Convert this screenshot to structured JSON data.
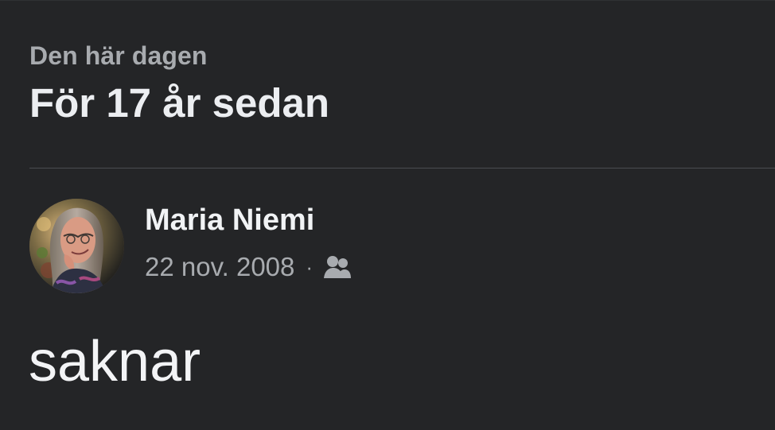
{
  "memory": {
    "eyebrow": "Den här dagen",
    "headline": "För 17 år sedan"
  },
  "post": {
    "author": "Maria Niemi",
    "date": "22 nov. 2008",
    "separator": "·",
    "audience_icon": "friends-icon",
    "text": "saknar"
  },
  "colors": {
    "background": "#242527",
    "primary_text": "#eceef1",
    "secondary_text": "#a8abaf",
    "divider": "#4a4c50"
  }
}
